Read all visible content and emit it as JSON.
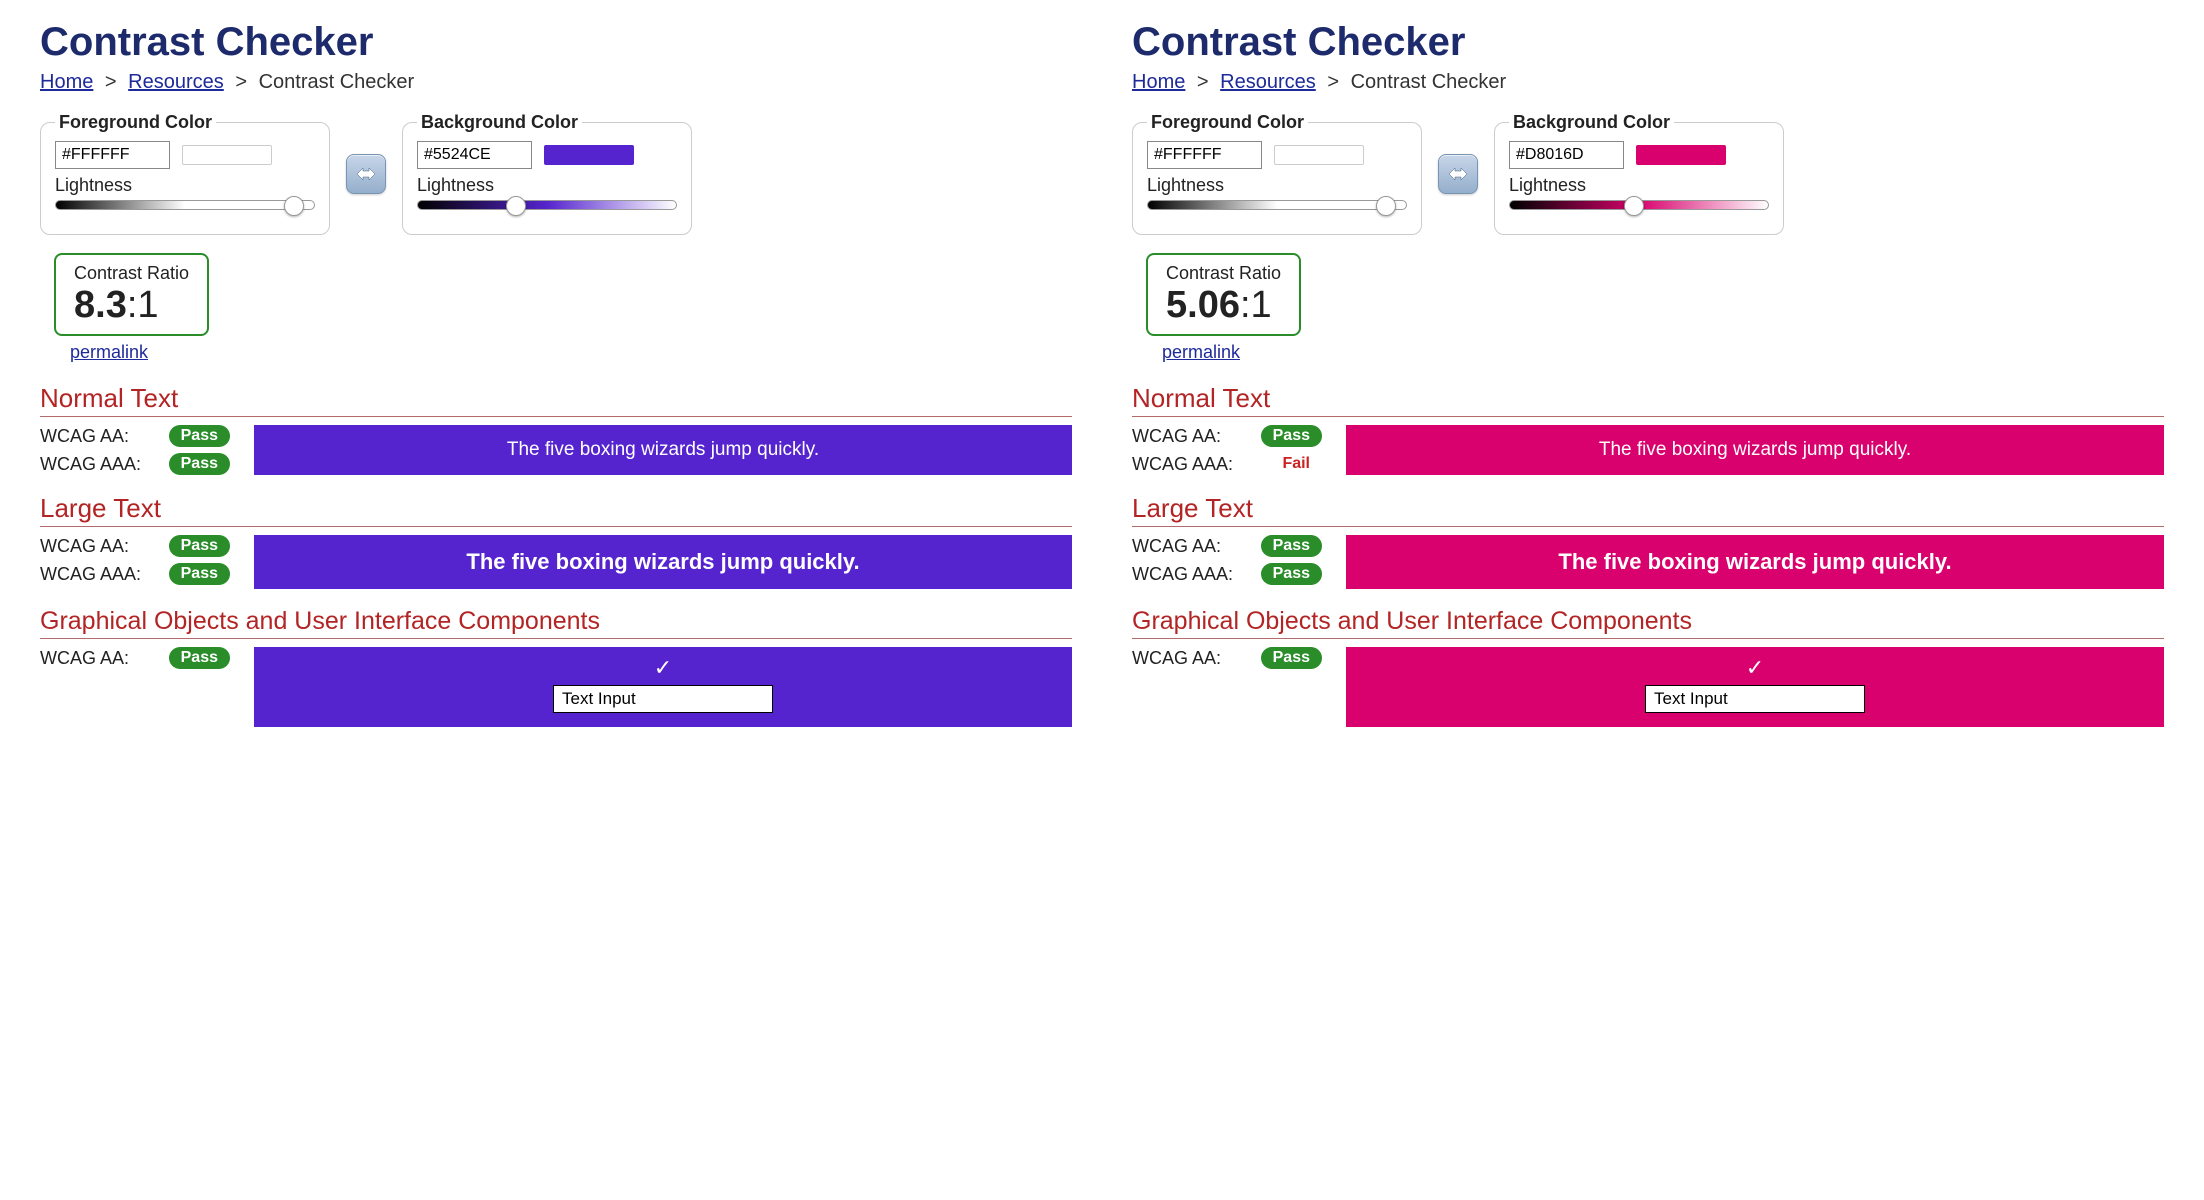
{
  "panels": [
    {
      "title": "Contrast Checker",
      "breadcrumb": {
        "home": "Home",
        "resources": "Resources",
        "current": "Contrast Checker"
      },
      "fg": {
        "legend": "Foreground Color",
        "hex": "#FFFFFF",
        "lightness": "Lightness",
        "swatch": "#FFFFFF",
        "gradient_to": "#FFFFFF",
        "thumb_pct": 92
      },
      "bg": {
        "legend": "Background Color",
        "hex": "#5524CE",
        "lightness": "Lightness",
        "swatch": "#5524CE",
        "gradient_to": "#5524CE",
        "thumb_pct": 38
      },
      "ratio": {
        "label": "Contrast Ratio",
        "value": "8.3",
        "suffix": ":1"
      },
      "permalink": "permalink",
      "normal": {
        "heading": "Normal Text",
        "aa_label": "WCAG AA:",
        "aa": "Pass",
        "aaa_label": "WCAG AAA:",
        "aaa": "Pass",
        "sample": "The five boxing wizards jump quickly."
      },
      "large": {
        "heading": "Large Text",
        "aa_label": "WCAG AA:",
        "aa": "Pass",
        "aaa_label": "WCAG AAA:",
        "aaa": "Pass",
        "sample": "The five boxing wizards jump quickly."
      },
      "ui": {
        "heading": "Graphical Objects and User Interface Components",
        "aa_label": "WCAG AA:",
        "aa": "Pass",
        "input": "Text Input"
      },
      "sample_bg": "#5524CE"
    },
    {
      "title": "Contrast Checker",
      "breadcrumb": {
        "home": "Home",
        "resources": "Resources",
        "current": "Contrast Checker"
      },
      "fg": {
        "legend": "Foreground Color",
        "hex": "#FFFFFF",
        "lightness": "Lightness",
        "swatch": "#FFFFFF",
        "gradient_to": "#FFFFFF",
        "thumb_pct": 92
      },
      "bg": {
        "legend": "Background Color",
        "hex": "#D8016D",
        "lightness": "Lightness",
        "swatch": "#D8016D",
        "gradient_to": "#D8016D",
        "thumb_pct": 48
      },
      "ratio": {
        "label": "Contrast Ratio",
        "value": "5.06",
        "suffix": ":1"
      },
      "permalink": "permalink",
      "normal": {
        "heading": "Normal Text",
        "aa_label": "WCAG AA:",
        "aa": "Pass",
        "aaa_label": "WCAG AAA:",
        "aaa": "Fail",
        "sample": "The five boxing wizards jump quickly."
      },
      "large": {
        "heading": "Large Text",
        "aa_label": "WCAG AA:",
        "aa": "Pass",
        "aaa_label": "WCAG AAA:",
        "aaa": "Pass",
        "sample": "The five boxing wizards jump quickly."
      },
      "ui": {
        "heading": "Graphical Objects and User Interface Components",
        "aa_label": "WCAG AA:",
        "aa": "Pass",
        "input": "Text Input"
      },
      "sample_bg": "#D8016D"
    }
  ]
}
